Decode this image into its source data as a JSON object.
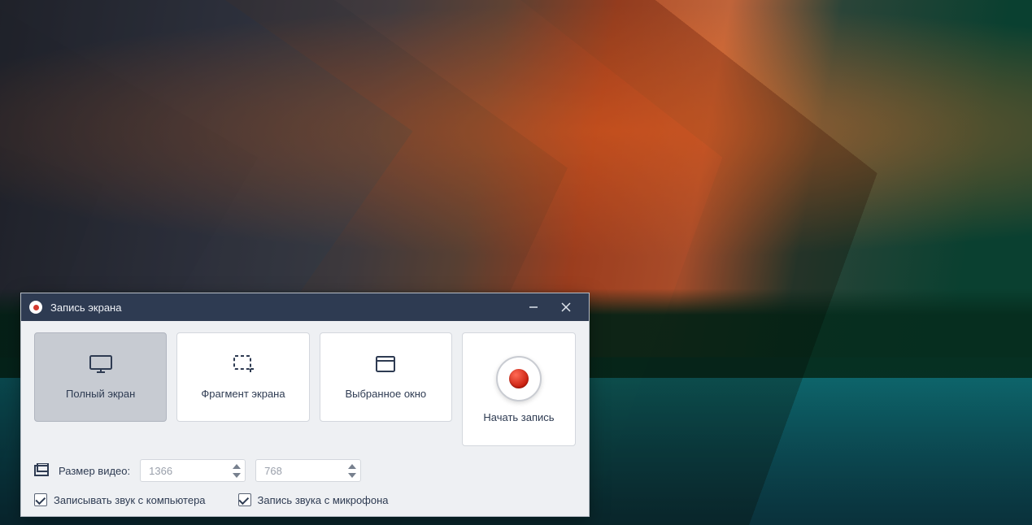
{
  "window": {
    "title": "Запись экрана"
  },
  "modes": {
    "fullscreen": "Полный экран",
    "fragment": "Фрагмент экрана",
    "window": "Выбранное окно",
    "active": "fullscreen"
  },
  "record": {
    "label": "Начать запись"
  },
  "size": {
    "label": "Размер видео:",
    "width": "1366",
    "height": "768"
  },
  "audio": {
    "system_label": "Записывать звук с компьютера",
    "mic_label": "Запись звука с микрофона",
    "system_checked": true,
    "mic_checked": true
  }
}
